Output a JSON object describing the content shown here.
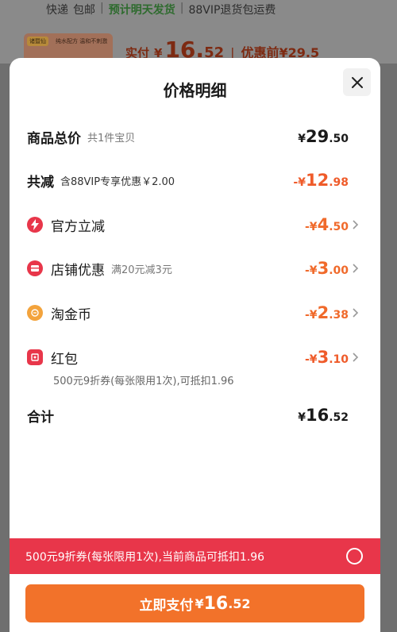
{
  "background": {
    "shipping": {
      "express": "快递",
      "free": "包邮",
      "sep": "|",
      "eta": "预计明天发货",
      "return": "88VIP退货包运费"
    },
    "thumb_tags": {
      "tag1": "诸暨仙",
      "tag2": "纯水配方 温和不刺激"
    },
    "price": {
      "label": "实付",
      "currency": "¥",
      "int": "16.",
      "dec": "52",
      "pipe": "|",
      "before": "优惠前¥29.5"
    }
  },
  "sheet": {
    "title": "价格明细",
    "rows": [
      {
        "main": "商品总价",
        "sub": "共1件宝贝",
        "currency": "¥",
        "int": "29",
        "dec": ".50"
      },
      {
        "main": "共减",
        "sub": "含88VIP专享优惠￥2.00",
        "currency": "-¥",
        "int": "12",
        "dec": ".98"
      },
      {
        "main": "官方立减",
        "sub": "",
        "currency": "-¥",
        "int": "4",
        "dec": ".50",
        "icon": "lightning-icon"
      },
      {
        "main": "店铺优惠",
        "sub": "满20元减3元",
        "currency": "-¥",
        "int": "3",
        "dec": ".00",
        "icon": "shop-icon"
      },
      {
        "main": "淘金币",
        "sub": "",
        "currency": "-¥",
        "int": "2",
        "dec": ".38",
        "icon": "coin-icon"
      },
      {
        "main": "红包",
        "sub": "",
        "currency": "-¥",
        "int": "3",
        "dec": ".10",
        "icon": "red-packet-icon"
      },
      {
        "main": "合计",
        "sub": "",
        "currency": "¥",
        "int": "16",
        "dec": ".52"
      }
    ],
    "redpacket_note": "500元9折券(每张限用1次),可抵扣1.96"
  },
  "coupon_bar": {
    "text": "500元9折券(每张限用1次),当前商品可抵扣1.96"
  },
  "pay_button": {
    "label": "立即支付",
    "currency": "¥",
    "int": "16",
    "dec": ".52"
  },
  "colors": {
    "accent_orange": "#f2722a",
    "coupon_red": "#e8364a",
    "discount_orange": "#f06a2b"
  }
}
